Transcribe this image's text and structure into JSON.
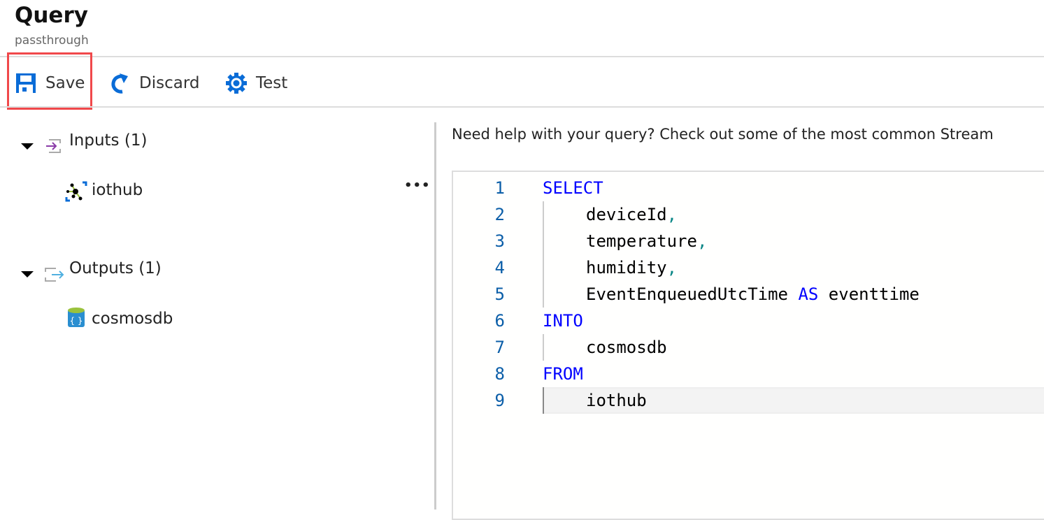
{
  "header": {
    "title": "Query",
    "subtitle": "passthrough"
  },
  "toolbar": {
    "save": "Save",
    "discard": "Discard",
    "test": "Test"
  },
  "tree": {
    "inputs": {
      "label": "Inputs (1)",
      "items": [
        "iothub"
      ]
    },
    "outputs": {
      "label": "Outputs (1)",
      "items": [
        "cosmosdb"
      ]
    },
    "more": "•••"
  },
  "help_text": "Need help with your query? Check out some of the most common Stream",
  "editor": {
    "lines": [
      {
        "n": "1",
        "kw": "SELECT"
      },
      {
        "n": "2",
        "text": "deviceId",
        "sep": ","
      },
      {
        "n": "3",
        "text": "temperature",
        "sep": ","
      },
      {
        "n": "4",
        "text": "humidity",
        "sep": ","
      },
      {
        "n": "5",
        "text": "EventEnqueuedUtcTime ",
        "kw2": "AS",
        "text2": " eventtime"
      },
      {
        "n": "6",
        "kw": "INTO"
      },
      {
        "n": "7",
        "text": "cosmosdb"
      },
      {
        "n": "8",
        "kw": "FROM"
      },
      {
        "n": "9",
        "text": "iothub"
      }
    ]
  },
  "colors": {
    "accent": "#0a6cd7",
    "highlight": "#f0484b",
    "keyword": "#0000ff"
  }
}
